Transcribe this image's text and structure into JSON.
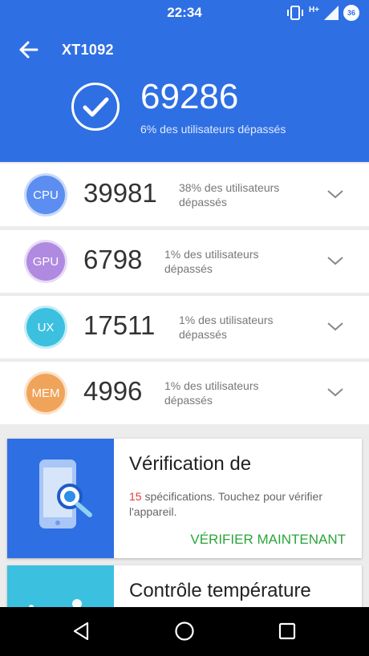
{
  "status_bar": {
    "time": "22:34",
    "network": "H+",
    "battery": "36"
  },
  "header": {
    "device": "XT1092",
    "total_score": "69286",
    "total_subtitle": "6% des utilisateurs dépassés"
  },
  "scores": [
    {
      "label": "CPU",
      "value": "39981",
      "desc": "38% des utilisateurs dépassés",
      "color": "#5b8ef0"
    },
    {
      "label": "GPU",
      "value": "6798",
      "desc": "1% des utilisateurs dépassés",
      "color": "#b08ae0"
    },
    {
      "label": "UX",
      "value": "17511",
      "desc": "1% des utilisateurs dépassés",
      "color": "#3cc0e0"
    },
    {
      "label": "MEM",
      "value": "4996",
      "desc": "1% des utilisateurs dépassés",
      "color": "#f0a45a"
    }
  ],
  "verify_card": {
    "title": "Vérification de",
    "count": "15",
    "text": " spécifications. Touchez pour vérifier l'appareil.",
    "action": "VÉRIFIER MAINTENANT",
    "color": "#2f6fe4"
  },
  "temp_card": {
    "title": "Contrôle température",
    "color": "#3cc0e0"
  }
}
